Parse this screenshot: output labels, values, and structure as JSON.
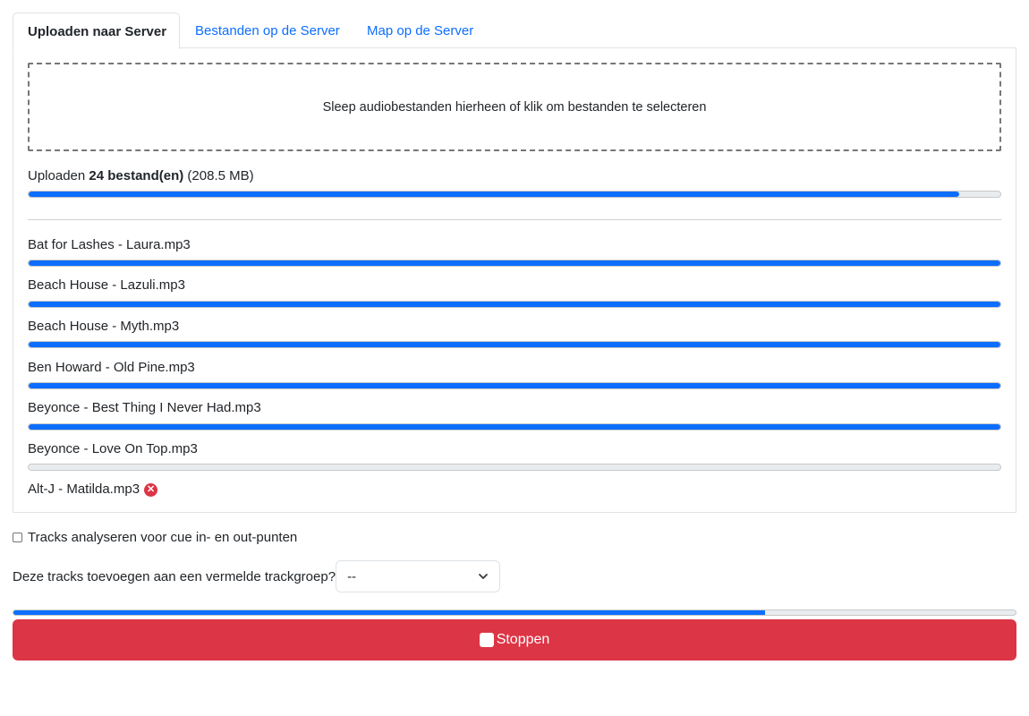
{
  "tabs": [
    {
      "label": "Uploaden naar Server",
      "active": true
    },
    {
      "label": "Bestanden op de Server",
      "active": false
    },
    {
      "label": "Map op de Server",
      "active": false
    }
  ],
  "dropzone": {
    "text": "Sleep audiobestanden hierheen of klik om bestanden te selecteren"
  },
  "summary": {
    "prefix": "Uploaden",
    "count": "24 bestand(en)",
    "size": "(208.5 MB)",
    "progress": 0.958
  },
  "files": [
    {
      "name": "Bat for Lashes - Laura.mp3",
      "progress": 1.0
    },
    {
      "name": "Beach House - Lazuli.mp3",
      "progress": 1.0
    },
    {
      "name": "Beach House - Myth.mp3",
      "progress": 1.0
    },
    {
      "name": "Ben Howard - Old Pine.mp3",
      "progress": 1.0
    },
    {
      "name": "Beyonce - Best Thing I Never Had.mp3",
      "progress": 1.0
    },
    {
      "name": "Beyonce - Love On Top.mp3",
      "progress": 0.0
    }
  ],
  "failed_file": {
    "name": "Alt-J - Matilda.mp3",
    "icon": "error-icon"
  },
  "analyze_checkbox": {
    "label": "Tracks analyseren voor cue in- en out-punten",
    "checked": false
  },
  "track_group": {
    "label": "Deze tracks toevoegen aan een vermelde trackgroep?",
    "selected": "--"
  },
  "overall_progress": 0.75,
  "stop_button": {
    "label": "Stoppen",
    "icon": "stop-icon"
  },
  "colors": {
    "accent": "#0d6efd",
    "danger": "#dc3545",
    "track": "#e9ecef"
  }
}
